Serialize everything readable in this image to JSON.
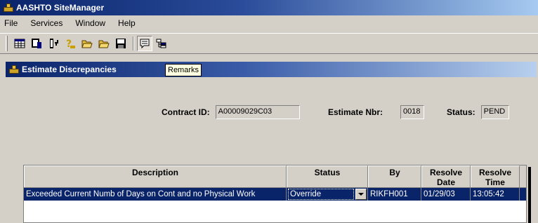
{
  "window": {
    "title": "AASHTO SiteManager"
  },
  "menu": [
    "File",
    "Services",
    "Window",
    "Help"
  ],
  "toolbar": {
    "buttons": [
      "table-icon",
      "report-icon",
      "insert-icon",
      "help-icon",
      "open-folder-icon",
      "open-folder-2-icon",
      "save-icon",
      "remarks-icon",
      "tree-icon"
    ]
  },
  "tooltip": {
    "text": "Remarks"
  },
  "child_window": {
    "title": "Estimate Discrepancies"
  },
  "form": {
    "contract_id_label": "Contract ID:",
    "contract_id_value": "A00009029C03",
    "estimate_nbr_label": "Estimate Nbr:",
    "estimate_nbr_value": "0018",
    "status_label": "Status:",
    "status_value": "PEND"
  },
  "grid": {
    "columns": [
      "Description",
      "Status",
      "By",
      "Resolve Date",
      "Resolve Time"
    ],
    "rows": [
      {
        "description": "Exceeded Current Numb of Days on Cont and no Physical Work",
        "status": "Override",
        "by": "RIKFH001",
        "resolve_date": "01/29/03",
        "resolve_time": "13:05:42"
      }
    ]
  },
  "colors": {
    "title_bar": "#0a246a",
    "face": "#d4d0c8",
    "selection": "#0a246a",
    "tooltip_bg": "#ffffe1"
  }
}
